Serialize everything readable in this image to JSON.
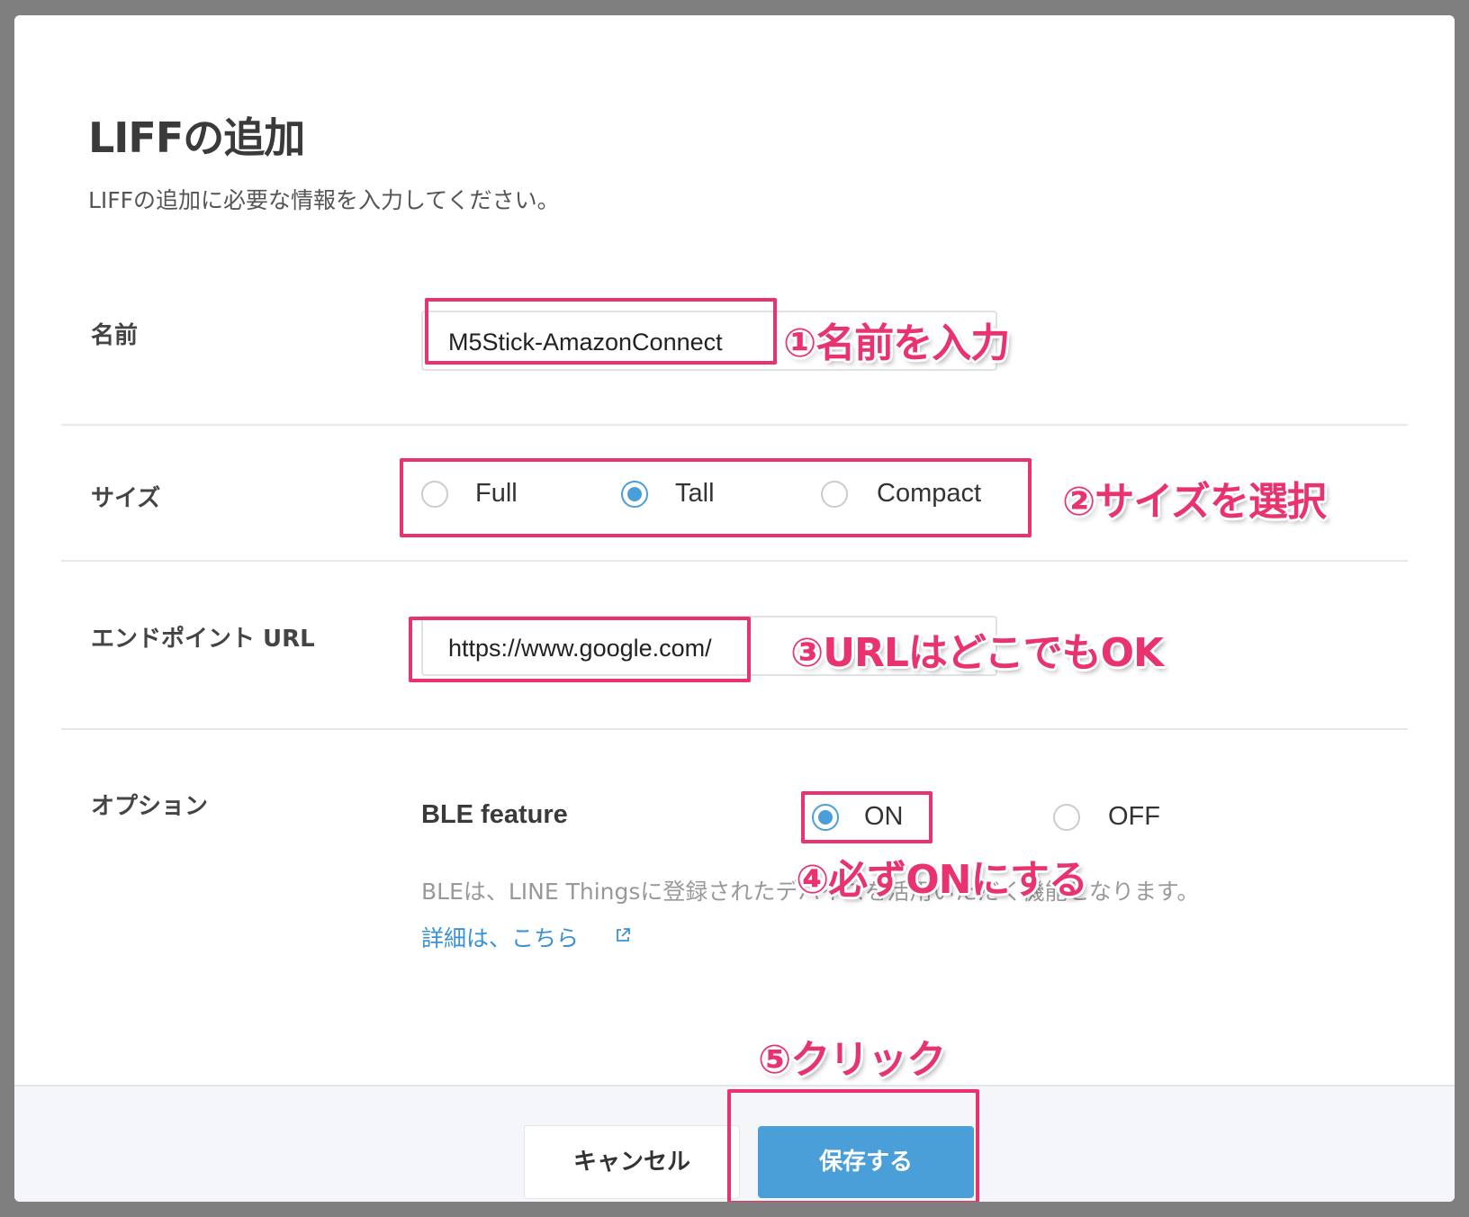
{
  "dialog": {
    "title": "LIFFの追加",
    "subtitle": "LIFFの追加に必要な情報を入力してください。"
  },
  "fields": {
    "name": {
      "label": "名前",
      "value": "M5Stick-AmazonConnect"
    },
    "size": {
      "label": "サイズ",
      "options": [
        "Full",
        "Tall",
        "Compact"
      ],
      "selected": "Tall"
    },
    "endpoint": {
      "label": "エンドポイント URL",
      "value": "https://www.google.com/"
    },
    "options": {
      "label": "オプション",
      "ble_label": "BLE feature",
      "on_label": "ON",
      "off_label": "OFF",
      "selected": "ON",
      "description": "BLEは、LINE Thingsに登録されたデバイスを活用いただく機能となります。",
      "link_text": "詳細は、こちら"
    }
  },
  "buttons": {
    "cancel": "キャンセル",
    "save": "保存する"
  },
  "annotations": {
    "step1": "①名前を入力",
    "step2": "②サイズを選択",
    "step3": "③URLはどこでもOK",
    "step4": "④必ずONにする",
    "step5": "⑤クリック"
  },
  "colors": {
    "accent": "#4a9fd8",
    "annotation": "#e8336e",
    "link": "#3a92d4"
  },
  "icons": {
    "external_link": "external-link-icon"
  }
}
